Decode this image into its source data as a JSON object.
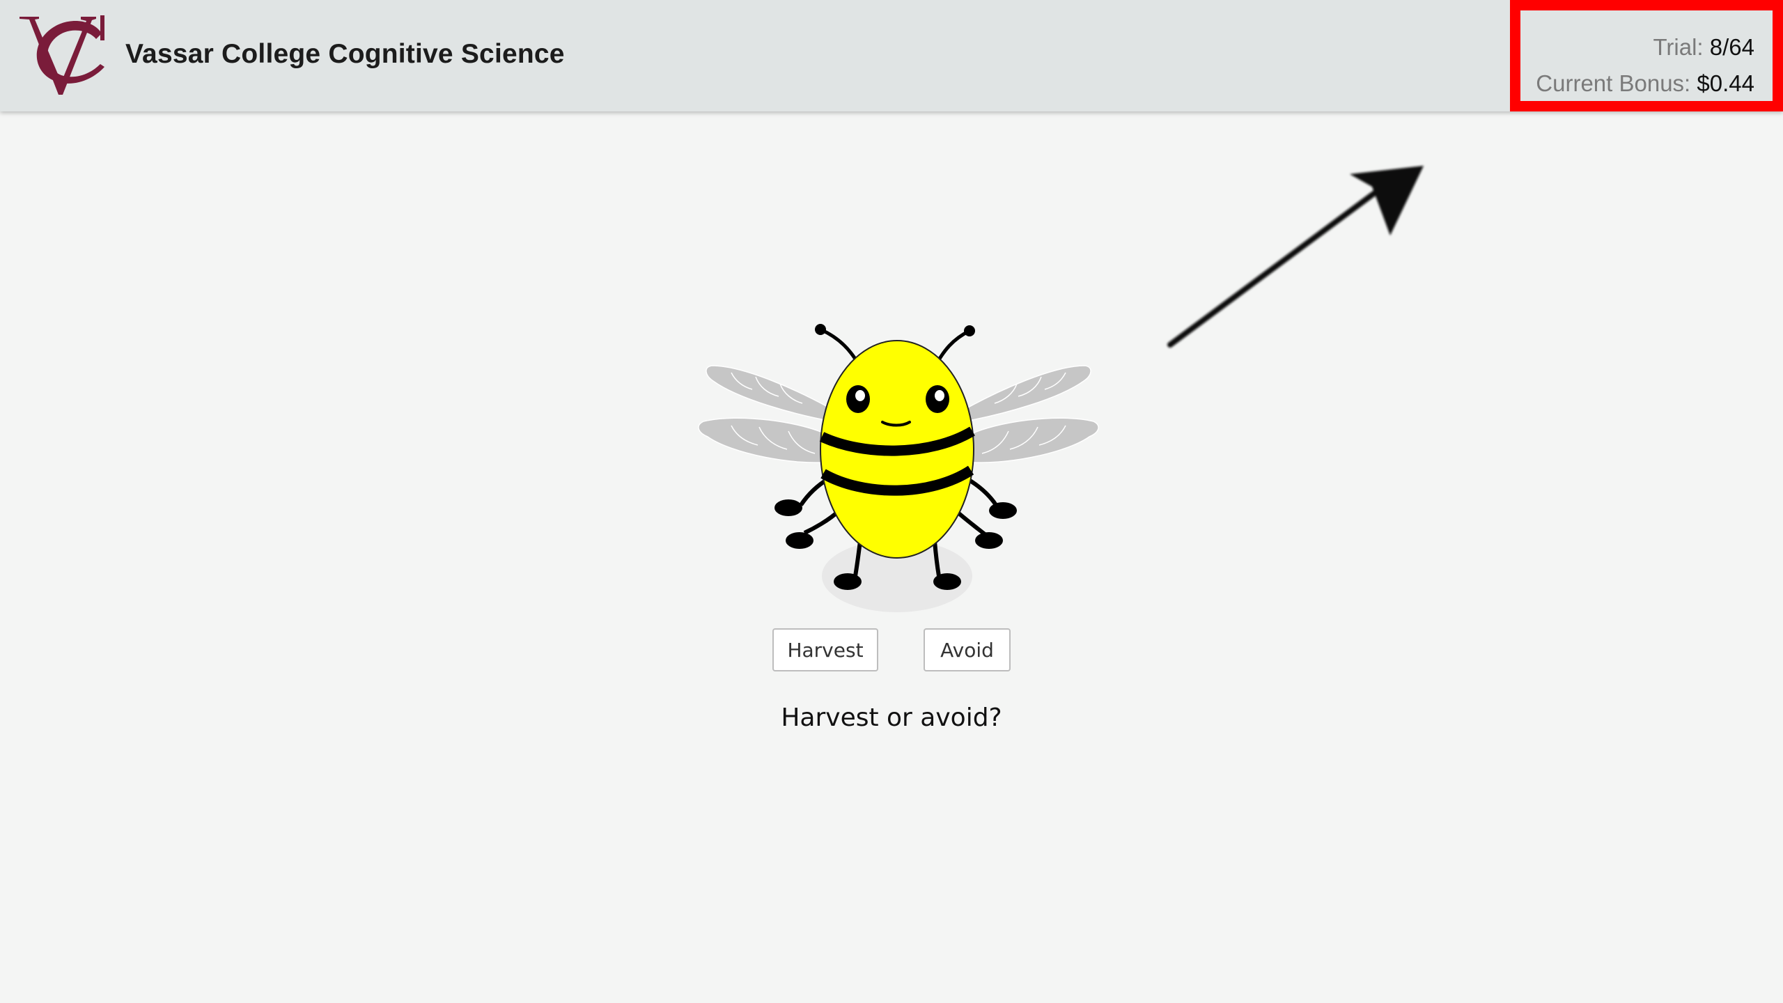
{
  "header": {
    "title": "Vassar College Cognitive Science",
    "logo_icon": "vassar-vc-logo",
    "brand_color": "#7a1c3a"
  },
  "status": {
    "trial_label": "Trial:",
    "trial_value": "8/64",
    "bonus_label": "Current Bonus:",
    "bonus_value": "$0.44",
    "highlight_color": "#ff0000"
  },
  "annotation": {
    "arrow_icon": "arrow-up-right-icon"
  },
  "stimulus": {
    "image_icon": "bee-icon",
    "body_color": "#ffff00"
  },
  "buttons": {
    "harvest_label": "Harvest",
    "avoid_label": "Avoid"
  },
  "prompt": {
    "text": "Harvest or avoid?"
  }
}
